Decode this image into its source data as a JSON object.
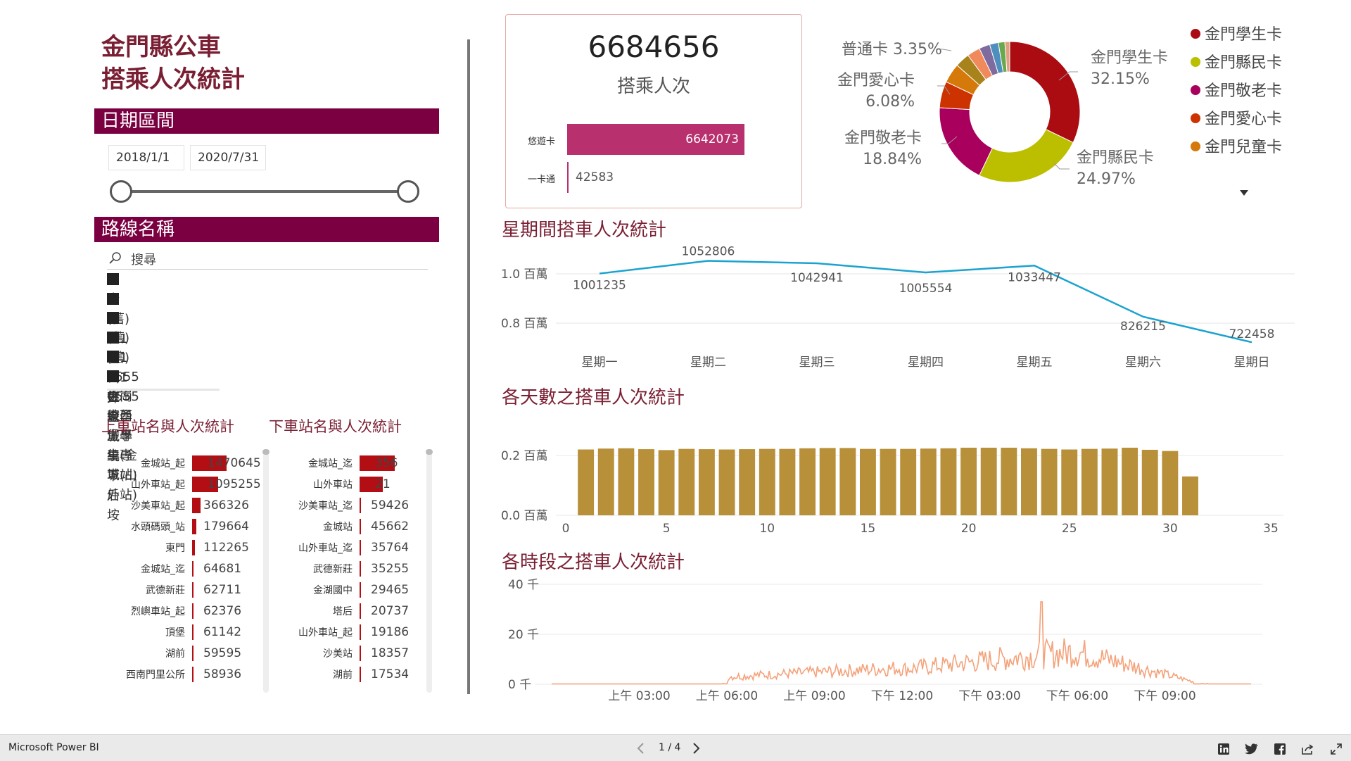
{
  "page_title": {
    "line1": "金門縣公車",
    "line2": "搭乘人次統計"
  },
  "date_filter": {
    "header": "日期區間",
    "start": "2018/1/1",
    "end": "2020/7/31"
  },
  "route_filter": {
    "header": "路線名稱",
    "search_placeholder": "搜尋",
    "items": [
      "全選",
      "(舊)藍1往山外",
      "(舊)藍1往金城",
      "(舊)藍1往金城繞下后垵",
      "0555古崗線學生專車(金城站)",
      "0555東西堡學生專車(山外站)"
    ]
  },
  "boarding": {
    "title": "上車站名與人次統計",
    "stations": [
      {
        "name": "金城站_起",
        "value": "1470645",
        "v": 1470645
      },
      {
        "name": "山外車站_起",
        "value": "1095255",
        "v": 1095255
      },
      {
        "name": "沙美車站_起",
        "value": "366326",
        "v": 366326
      },
      {
        "name": "水頭碼頭_站",
        "value": "179664",
        "v": 179664
      },
      {
        "name": "東門",
        "value": "112265",
        "v": 112265
      },
      {
        "name": "金城站_迄",
        "value": "64681",
        "v": 64681
      },
      {
        "name": "武德新莊",
        "value": "62711",
        "v": 62711
      },
      {
        "name": "烈嶼車站_起",
        "value": "62376",
        "v": 62376
      },
      {
        "name": "頂堡",
        "value": "61142",
        "v": 61142
      },
      {
        "name": "湖前",
        "value": "59595",
        "v": 59595
      },
      {
        "name": "西南門里公所",
        "value": "58936",
        "v": 58936
      }
    ]
  },
  "alighting": {
    "title": "下車站名與人次統計",
    "stations": [
      {
        "name": "金城站_迄",
        "value": "356",
        "v": 1500000
      },
      {
        "name": "山外車站",
        "value": "21",
        "v": 1000000
      },
      {
        "name": "沙美車站_迄",
        "value": "59426",
        "v": 59426
      },
      {
        "name": "金城站",
        "value": "45662",
        "v": 45662
      },
      {
        "name": "山外車站_迄",
        "value": "35764",
        "v": 35764
      },
      {
        "name": "武德新莊",
        "value": "35255",
        "v": 35255
      },
      {
        "name": "金湖國中",
        "value": "29465",
        "v": 29465
      },
      {
        "name": "塔后",
        "value": "20737",
        "v": 20737
      },
      {
        "name": "山外車站_起",
        "value": "19186",
        "v": 19186
      },
      {
        "name": "沙美站",
        "value": "18357",
        "v": 18357
      },
      {
        "name": "湖前",
        "value": "17534",
        "v": 17534
      }
    ]
  },
  "kpi": {
    "value": "6684656",
    "label": "搭乘人次",
    "cards": [
      {
        "name": "悠遊卡",
        "value": "6642073",
        "v": 6642073
      },
      {
        "name": "一卡通",
        "value": "42583",
        "v": 42583
      }
    ],
    "bar_color": "#b8306d"
  },
  "card_type_chart": {
    "type": "pie",
    "labels": [
      {
        "name": "普通卡",
        "pct": "3.35%"
      },
      {
        "name": "金門愛心卡",
        "pct": "6.08%"
      },
      {
        "name": "金門敬老卡",
        "pct": "18.84%"
      },
      {
        "name": "金門學生卡",
        "pct": "32.15%"
      },
      {
        "name": "金門縣民卡",
        "pct": "24.97%"
      }
    ],
    "slices": [
      {
        "name": "金門學生卡",
        "value": 32.15,
        "color": "#aa0c12"
      },
      {
        "name": "金門縣民卡",
        "value": 24.97,
        "color": "#bcbe00"
      },
      {
        "name": "金門敬老卡",
        "value": 18.84,
        "color": "#a8005c"
      },
      {
        "name": "金門愛心卡",
        "value": 6.08,
        "color": "#cc3300"
      },
      {
        "name": "金門兒童卡",
        "value": 4.5,
        "color": "#d4790a"
      },
      {
        "name": "",
        "value": 3.35,
        "color": "#a8821a"
      },
      {
        "name": "",
        "value": 3.0,
        "color": "#f08a5d"
      },
      {
        "name": "",
        "value": 2.5,
        "color": "#7f6b9e"
      },
      {
        "name": "",
        "value": 2.0,
        "color": "#4f8fc0"
      },
      {
        "name": "",
        "value": 1.5,
        "color": "#6aa84f"
      },
      {
        "name": "",
        "value": 1.11,
        "color": "#e0a080"
      }
    ],
    "legend": [
      {
        "name": "金門學生卡",
        "color": "#aa0c12"
      },
      {
        "name": "金門縣民卡",
        "color": "#bcbe00"
      },
      {
        "name": "金門敬老卡",
        "color": "#a8005c"
      },
      {
        "name": "金門愛心卡",
        "color": "#cc3300"
      },
      {
        "name": "金門兒童卡",
        "color": "#d4790a"
      }
    ]
  },
  "weekday_chart": {
    "title": "星期間搭車人次統計",
    "type": "line",
    "color": "#1aa3d0",
    "categories": [
      "星期一",
      "星期二",
      "星期三",
      "星期四",
      "星期五",
      "星期六",
      "星期日"
    ],
    "values": [
      1001235,
      1052806,
      1042941,
      1005554,
      1033447,
      826215,
      722458
    ],
    "value_labels": [
      "1001235",
      "1052806",
      "1042941",
      "1005554",
      "1033447",
      "826215",
      "722458"
    ],
    "ylim": [
      700000,
      1100000
    ],
    "yticks": [
      {
        "v": 1000000,
        "label": "1.0 百萬"
      },
      {
        "v": 800000,
        "label": "0.8 百萬"
      }
    ]
  },
  "day_chart": {
    "title": "各天數之搭車人次統計",
    "type": "bar",
    "color": "#b8903a",
    "x": [
      1,
      2,
      3,
      4,
      5,
      6,
      7,
      8,
      9,
      10,
      11,
      12,
      13,
      14,
      15,
      16,
      17,
      18,
      19,
      20,
      21,
      22,
      23,
      24,
      25,
      26,
      27,
      28,
      29,
      30,
      31
    ],
    "values": [
      220000,
      223000,
      224000,
      221000,
      218000,
      222000,
      221000,
      220000,
      221000,
      222000,
      222000,
      224000,
      225000,
      225000,
      222000,
      222000,
      222000,
      223000,
      224000,
      226000,
      226000,
      226000,
      224000,
      222000,
      220000,
      222000,
      223000,
      226000,
      219000,
      215000,
      130000
    ],
    "xlim": [
      0,
      35
    ],
    "xticks": [
      0,
      5,
      10,
      15,
      20,
      25,
      30,
      35
    ],
    "ylim": [
      0,
      240000
    ],
    "yticks": [
      {
        "v": 200000,
        "label": "0.2 百萬"
      },
      {
        "v": 0,
        "label": "0.0 百萬"
      }
    ]
  },
  "hour_chart": {
    "title": "各時段之搭車人次統計",
    "type": "line",
    "color": "#f4a27a",
    "xticks": [
      "上午 03:00",
      "上午 06:00",
      "上午 09:00",
      "下午 12:00",
      "下午 03:00",
      "下午 06:00",
      "下午 09:00"
    ],
    "ylim": [
      0,
      40000
    ],
    "yticks": [
      {
        "v": 40000,
        "label": "40 千"
      },
      {
        "v": 20000,
        "label": "20 千"
      },
      {
        "v": 0,
        "label": "0 千"
      }
    ]
  },
  "bottom_bar": {
    "app_name": "Microsoft Power BI",
    "page": "1 / 4"
  }
}
